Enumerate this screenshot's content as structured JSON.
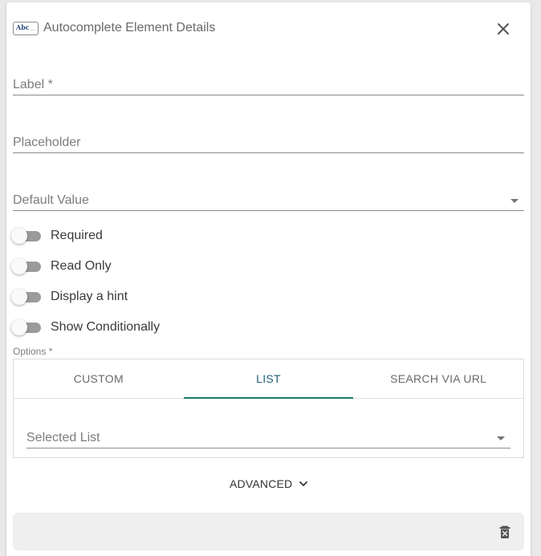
{
  "header": {
    "title": "Autocomplete Element Details",
    "type_icon_text": "Abc",
    "type_icon_dots": "...",
    "type_icon": "text-field-icon",
    "close_icon": "close-icon"
  },
  "fields": {
    "label": "Label *",
    "placeholder": "Placeholder",
    "default_value": "Default Value"
  },
  "toggles": [
    {
      "label": "Required",
      "on": false
    },
    {
      "label": "Read Only",
      "on": false
    },
    {
      "label": "Display a hint",
      "on": false
    },
    {
      "label": "Show Conditionally",
      "on": false
    }
  ],
  "options": {
    "label": "Options *",
    "tabs": [
      {
        "label": "CUSTOM",
        "active": false
      },
      {
        "label": "LIST",
        "active": true
      },
      {
        "label": "SEARCH VIA URL",
        "active": false
      }
    ],
    "selected_list_placeholder": "Selected List"
  },
  "advanced": {
    "label": "ADVANCED",
    "icon": "chevron-down-icon"
  },
  "footer": {
    "delete_icon": "delete-icon"
  },
  "colors": {
    "accent": "#1e7a6e",
    "active_tab_text": "#1e5f74",
    "toggle_track": "#9b9b9b"
  }
}
